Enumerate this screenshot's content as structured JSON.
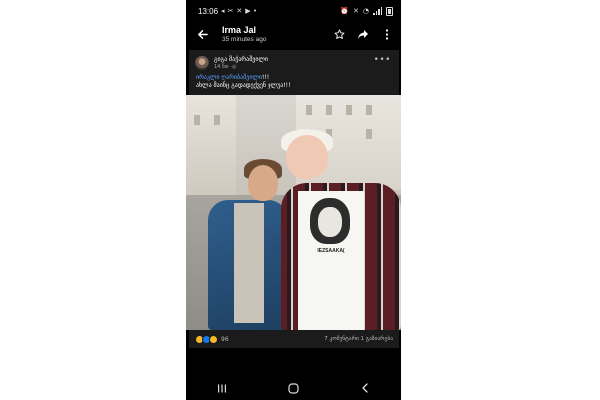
{
  "status_bar": {
    "time": "13:06",
    "icons": [
      "telegram-icon",
      "tools-icon",
      "cross-icon",
      "youtube-icon",
      "dot-icon",
      "alarm-icon",
      "mute-icon",
      "wifi-icon",
      "signal-icon",
      "battery-icon"
    ]
  },
  "header": {
    "title": "Irma Jal",
    "subtitle": "35 minutes ago",
    "icons": [
      "back-arrow-icon",
      "star-icon",
      "share-icon",
      "more-vertical-icon"
    ]
  },
  "post": {
    "author": "გიგა მაჭარაშვილი",
    "time": "14 წთ",
    "line1_link": "ირაკლი ღარიბაშვილი",
    "line1_rest": "!!!",
    "line2": "ახლა მაინც გადადექვენ ჯლუა!!!",
    "photo_shirt_text": "IEZSAAKA(",
    "reaction_count": "96",
    "stats": "7 კომენტარი 1 გაზიარება",
    "colors": {
      "link": "#5aa0ff",
      "card_bg": "#1b1b1b"
    }
  },
  "nav": {
    "icons": [
      "recents-icon",
      "home-icon",
      "back-icon"
    ]
  }
}
